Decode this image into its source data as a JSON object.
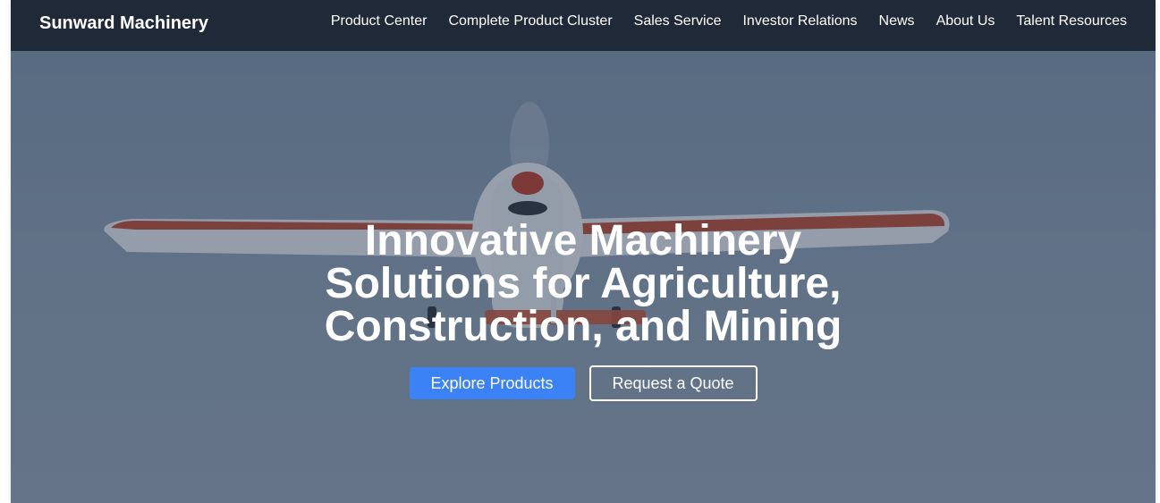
{
  "header": {
    "brand": "Sunward Machinery",
    "nav": [
      "Product Center",
      "Complete Product Cluster",
      "Sales Service",
      "Investor Relations",
      "News",
      "About Us",
      "Talent Resources"
    ]
  },
  "hero": {
    "headline_lines": [
      "Innovative Machinery",
      "Solutions for Agriculture,",
      "Construction, and Mining"
    ],
    "primary_button": "Explore Products",
    "secondary_button": "Request a Quote",
    "image_subject": "airplane-photo"
  },
  "colors": {
    "navbar_bg": "#1f2937",
    "primary_button_bg": "#3b82f6",
    "text": "#ffffff"
  }
}
